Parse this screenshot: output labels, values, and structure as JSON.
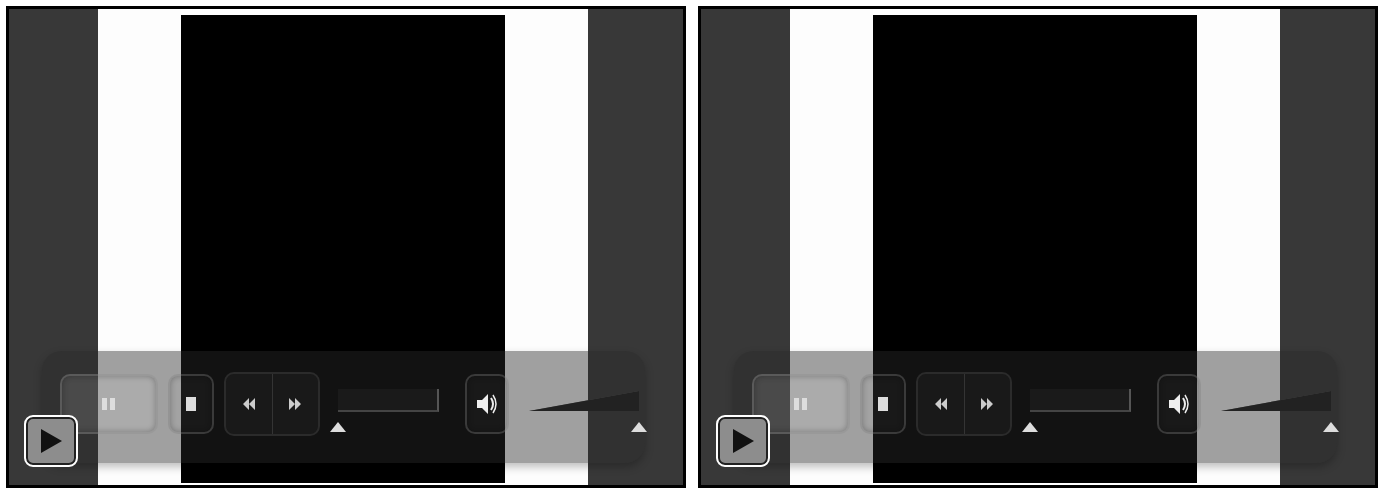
{
  "players": [
    {
      "volume": {
        "level": 1
      }
    },
    {
      "volume": {
        "level": 1
      }
    }
  ]
}
